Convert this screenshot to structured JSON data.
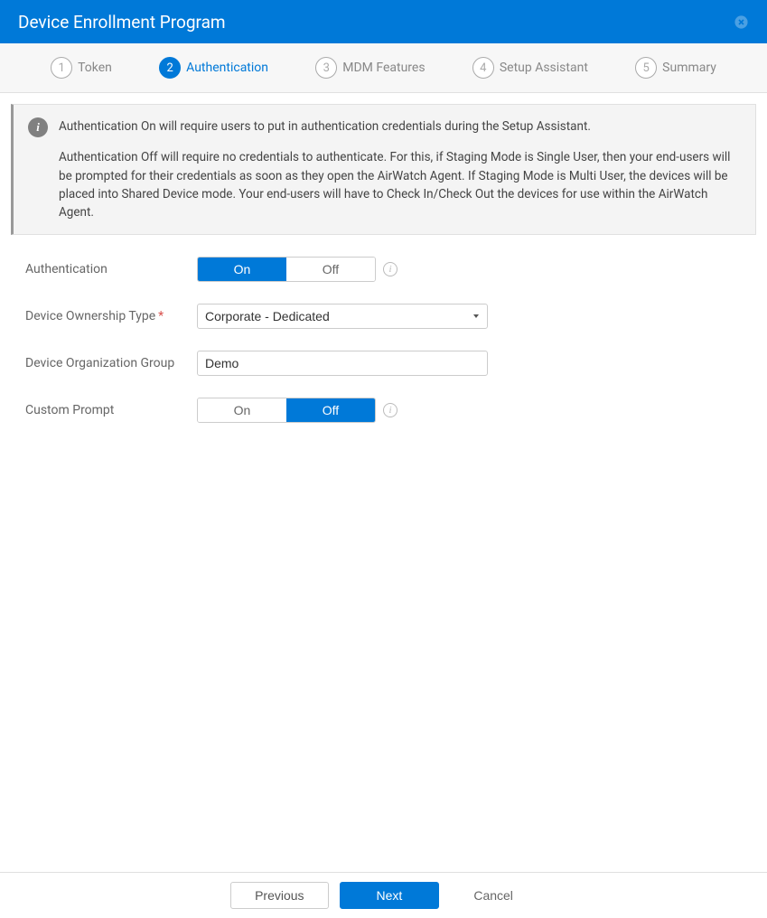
{
  "header": {
    "title": "Device Enrollment Program"
  },
  "steps": [
    {
      "number": "1",
      "label": "Token",
      "active": false
    },
    {
      "number": "2",
      "label": "Authentication",
      "active": true
    },
    {
      "number": "3",
      "label": "MDM Features",
      "active": false
    },
    {
      "number": "4",
      "label": "Setup Assistant",
      "active": false
    },
    {
      "number": "5",
      "label": "Summary",
      "active": false
    }
  ],
  "info": {
    "para1": "Authentication On will require users to put in authentication credentials during the Setup Assistant.",
    "para2": "Authentication Off will require no credentials to authenticate. For this, if Staging Mode is Single User, then your end-users will be prompted for their credentials as soon as they open the AirWatch Agent. If Staging Mode is Multi User, the devices will be placed into Shared Device mode. Your end-users will have to Check In/Check Out the devices for use within the AirWatch Agent."
  },
  "form": {
    "authentication": {
      "label": "Authentication",
      "options": {
        "on": "On",
        "off": "Off"
      },
      "value": "on"
    },
    "ownership": {
      "label": "Device Ownership Type",
      "value": "Corporate - Dedicated",
      "required": true
    },
    "org_group": {
      "label": "Device Organization Group",
      "value": "Demo"
    },
    "custom_prompt": {
      "label": "Custom Prompt",
      "options": {
        "on": "On",
        "off": "Off"
      },
      "value": "off"
    }
  },
  "footer": {
    "previous": "Previous",
    "next": "Next",
    "cancel": "Cancel"
  }
}
